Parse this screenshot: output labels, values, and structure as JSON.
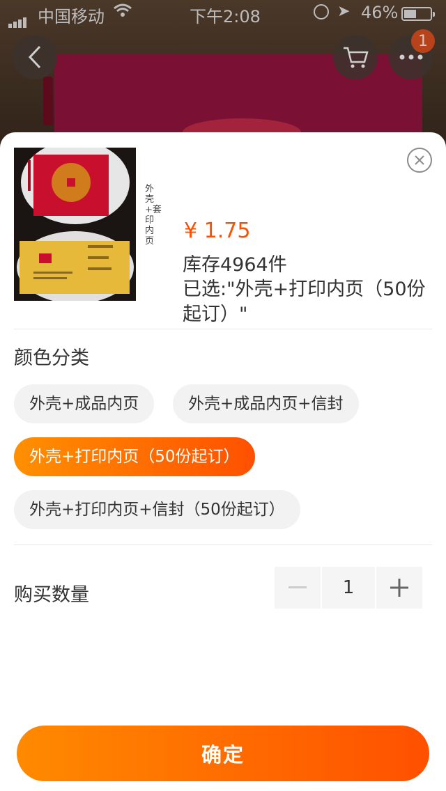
{
  "status_bar": {
    "carrier": "中国移动",
    "time": "下午2:08",
    "battery": "46%"
  },
  "header": {
    "badge_count": "1",
    "icons": [
      "back-icon",
      "cart-icon",
      "more-icon"
    ]
  },
  "sheet": {
    "thumbnail_caption": "外壳+套印内页",
    "price": "¥ 1.75",
    "stock": "库存4964件",
    "selected": "已选:\"外壳+打印内页（50份起订）\"",
    "color_section_title": "颜色分类",
    "color_options": [
      {
        "label": "外壳+成品内页",
        "selected": false
      },
      {
        "label": "外壳+成品内页+信封",
        "selected": false
      },
      {
        "label": "外壳+打印内页（50份起订）",
        "selected": true
      },
      {
        "label": "外壳+打印内页+信封（50份起订）",
        "selected": false
      }
    ],
    "quantity_label": "购买数量",
    "quantity": "1",
    "confirm_label": "确定"
  },
  "colors": {
    "accent": "#ff5000",
    "accent_start": "#ff9000",
    "chip_bg": "#f2f2f2"
  }
}
